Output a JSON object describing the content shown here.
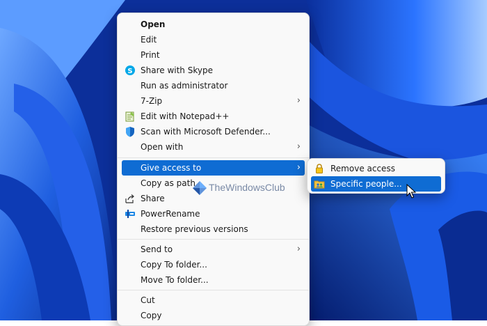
{
  "menu": {
    "items": [
      {
        "label": "Open",
        "icon": "",
        "submenu": false,
        "bold": true
      },
      {
        "label": "Edit",
        "icon": "",
        "submenu": false
      },
      {
        "label": "Print",
        "icon": "",
        "submenu": false
      },
      {
        "label": "Share with Skype",
        "icon": "skype-icon",
        "submenu": false
      },
      {
        "label": "Run as administrator",
        "icon": "",
        "submenu": false
      },
      {
        "label": "7-Zip",
        "icon": "",
        "submenu": true
      },
      {
        "label": "Edit with Notepad++",
        "icon": "notepad-plus-plus-icon",
        "submenu": false
      },
      {
        "label": "Scan with Microsoft Defender...",
        "icon": "defender-shield-icon",
        "submenu": false
      },
      {
        "label": "Open with",
        "icon": "",
        "submenu": true
      },
      {
        "label": "Give access to",
        "icon": "",
        "submenu": true,
        "highlighted": true
      },
      {
        "label": "Copy as path",
        "icon": "",
        "submenu": false
      },
      {
        "label": "Share",
        "icon": "share-icon",
        "submenu": false
      },
      {
        "label": "PowerRename",
        "icon": "powerrename-icon",
        "submenu": false
      },
      {
        "label": "Restore previous versions",
        "icon": "",
        "submenu": false
      },
      {
        "label": "Send to",
        "icon": "",
        "submenu": true
      },
      {
        "label": "Copy To folder...",
        "icon": "",
        "submenu": false
      },
      {
        "label": "Move To folder...",
        "icon": "",
        "submenu": false
      },
      {
        "label": "Cut",
        "icon": "",
        "submenu": false
      },
      {
        "label": "Copy",
        "icon": "",
        "submenu": false
      }
    ]
  },
  "submenu": {
    "items": [
      {
        "label": "Remove access",
        "icon": "lock-icon"
      },
      {
        "label": "Specific people...",
        "icon": "people-folder-icon",
        "highlighted": true
      }
    ]
  },
  "watermark": {
    "text": "TheWindowsClub"
  },
  "colors": {
    "highlight": "#0f6cd3",
    "menu_bg": "#f9f9f9",
    "desktop": "#0b3aa8"
  }
}
